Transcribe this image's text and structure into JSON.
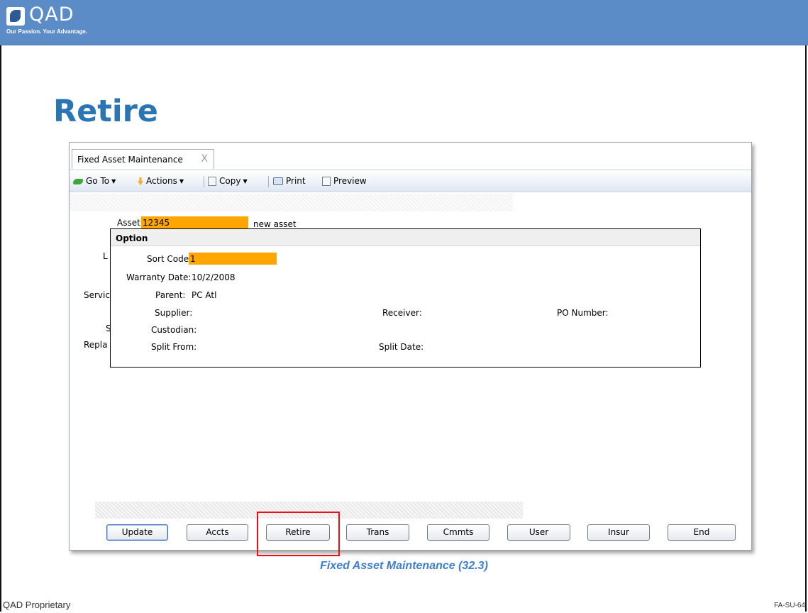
{
  "banner": {
    "logo_text": "QAD",
    "tagline": "Our Passion. Your Advantage.",
    "color": "#5b8cc8"
  },
  "slide": {
    "title": "Retire",
    "caption": "Fixed Asset Maintenance (32.3)",
    "footer_left": "QAD Proprietary",
    "footer_right": "FA-SU-64"
  },
  "window": {
    "tab_label": "Fixed Asset Maintenance",
    "tab_close": "X",
    "toolbar": {
      "goto": "Go To",
      "actions": "Actions",
      "copy": "Copy",
      "print": "Print",
      "preview": "Preview",
      "dropdown_caret": "▼"
    },
    "form": {
      "asset_label": "Asset:",
      "asset_value": "12345",
      "asset_description": "new asset",
      "hidden_labels": [
        "L",
        "Servic",
        "S",
        "Repla"
      ]
    },
    "option_dialog": {
      "title": "Option",
      "sort_code_label": "Sort Code:",
      "sort_code_value": "1",
      "warranty_date_label": "Warranty Date:",
      "warranty_date_value": "10/2/2008",
      "parent_label": "Parent:",
      "parent_value": "PC Atl",
      "supplier_label": "Supplier:",
      "receiver_label": "Receiver:",
      "po_number_label": "PO Number:",
      "custodian_label": "Custodian:",
      "split_from_label": "Split From:",
      "split_date_label": "Split Date:"
    },
    "buttons": {
      "update": "Update",
      "accts": "Accts",
      "retire": "Retire",
      "trans": "Trans",
      "cmmts": "Cmmts",
      "user": "User",
      "insur": "Insur",
      "end": "End"
    },
    "field_highlight_color": "#ffa600",
    "callout_color": "#ee1010"
  }
}
